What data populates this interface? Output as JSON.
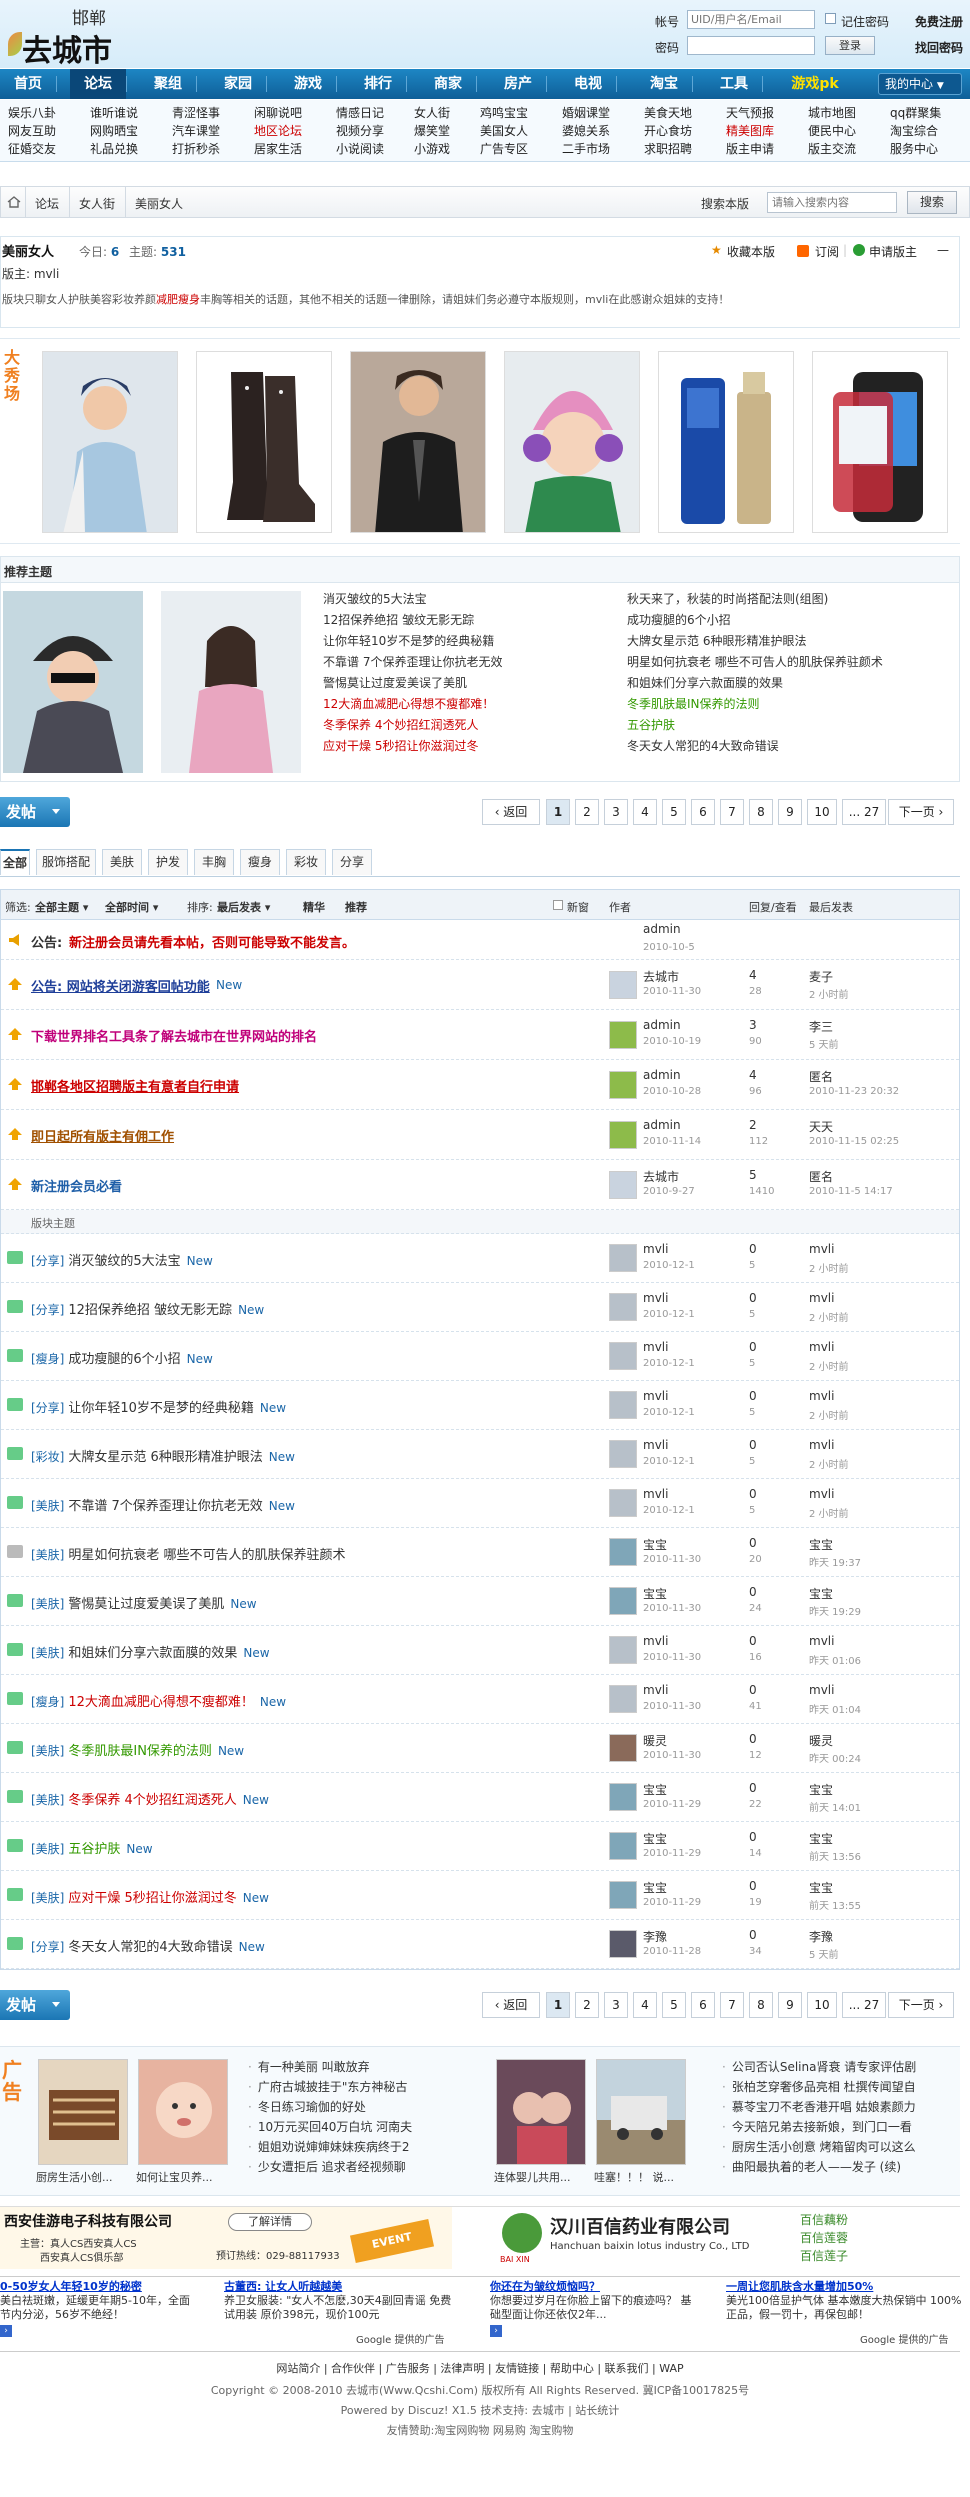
{
  "header": {
    "logo_sub": "邯郸",
    "logo_main": "去城市",
    "account_label": "帐号",
    "account_placeholder": "UID/用户名/Email",
    "remember": "记住密码",
    "register": "免费注册",
    "password_label": "密码",
    "login_button": "登录",
    "forgot": "找回密码"
  },
  "nav": {
    "items": [
      "首页",
      "论坛",
      "聚组",
      "家园",
      "游戏",
      "排行",
      "商家",
      "房产",
      "电视",
      "淘宝",
      "工具",
      "游戏pk"
    ],
    "center": "我的中心"
  },
  "subnav": {
    "cols": [
      [
        "娱乐八卦",
        "网友互助",
        "征婚交友"
      ],
      [
        "谁听谁说",
        "网购晒宝",
        "礼品兑换"
      ],
      [
        "青涩怪事",
        "汽车课堂",
        "打折秒杀"
      ],
      [
        "闲聊说吧",
        "地区论坛",
        "居家生活"
      ],
      [
        "情感日记",
        "视频分享",
        "小说阅读"
      ],
      [
        "女人街",
        "爆笑堂",
        "小游戏"
      ],
      [
        "鸡鸣宝宝",
        "美国女人",
        "广告专区"
      ],
      [
        "婚姻课堂",
        "婆媳关系",
        "二手市场"
      ],
      [
        "美食天地",
        "开心食坊",
        "求职招聘"
      ],
      [
        "天气预报",
        "精美图库",
        "版主申请"
      ],
      [
        "城市地图",
        "便民中心",
        "版主交流"
      ],
      [
        "qq群聚集",
        "淘宝综合",
        "服务中心"
      ]
    ]
  },
  "breadcrumb": {
    "items": [
      "论坛",
      "女人街",
      "美丽女人"
    ],
    "search_label": "搜索本版",
    "search_placeholder": "请输入搜索内容",
    "search_button": "搜索"
  },
  "forum": {
    "name": "美丽女人",
    "today_label": "今日:",
    "today": "6",
    "topics_label": "主题:",
    "topics": "531",
    "moderator": "版主: mvli",
    "desc_a": "版块只聊女人护肤美容彩妆养颜",
    "desc_b": "减肥瘦身",
    "desc_c": "丰胸等相关的话题，其他不相关的话题一律删除，请姐妹们务必遵守本版规则，mvli在此感谢众姐妹的支持！",
    "favorite": "收藏本版",
    "subscribe": "订阅",
    "apply": "申请版主",
    "collapse": "—"
  },
  "show": {
    "tag": "大秀场"
  },
  "recommend": {
    "title": "推荐主题",
    "col1": [
      {
        "t": "消灭皱纹的5大法宝",
        "c": "#333"
      },
      {
        "t": "12招保养绝招 皱纹无影无踪",
        "c": "#333"
      },
      {
        "t": "让你年轻10岁不是梦的经典秘籍",
        "c": "#333"
      },
      {
        "t": "不靠谱 7个保养歪理让你抗老无效",
        "c": "#333"
      },
      {
        "t": "警惕莫让过度爱美误了美肌",
        "c": "#333"
      },
      {
        "t": "12大滴血减肥心得想不瘦都难！",
        "c": "#c00"
      },
      {
        "t": "冬季保养 4个妙招红润透死人",
        "c": "#c00"
      },
      {
        "t": "应对干燥 5秒招让你滋润过冬",
        "c": "#c00"
      }
    ],
    "col2": [
      {
        "t": "秋天来了，秋装的时尚搭配法则(组图)",
        "c": "#333"
      },
      {
        "t": "成功瘦腿的6个小招",
        "c": "#333"
      },
      {
        "t": "大牌女星示范 6种眼形精准护眼法",
        "c": "#333"
      },
      {
        "t": "明星如何抗衰老 哪些不可告人的肌肤保养驻颜术",
        "c": "#333"
      },
      {
        "t": "和姐妹们分享六款面膜的效果",
        "c": "#333"
      },
      {
        "t": "冬季肌肤最IN保养的法则",
        "c": "#390"
      },
      {
        "t": "五谷护肤",
        "c": "#390"
      },
      {
        "t": "冬天女人常犯的4大致命错误",
        "c": "#333"
      }
    ]
  },
  "post_button": "发帖",
  "pager": {
    "prev": "‹ 返回",
    "pages": [
      "1",
      "2",
      "3",
      "4",
      "5",
      "6",
      "7",
      "8",
      "9",
      "10"
    ],
    "last": "... 27",
    "next": "下一页 ›"
  },
  "tabs": [
    "全部",
    "服饰搭配",
    "美肤",
    "护发",
    "丰胸",
    "瘦身",
    "彩妆",
    "分享"
  ],
  "table_head": {
    "filter": "筛选:",
    "all_topics": "全部主题",
    "all_time": "全部时间",
    "sort": "排序:",
    "latest": "最后发表",
    "digest": "精华",
    "recommend": "推荐",
    "new_window": "新窗",
    "author": "作者",
    "replies": "回复/查看",
    "last": "最后发表"
  },
  "announce": {
    "label": "公告:",
    "text": "新注册会员请先看本帖，否则可能导致不能发言。",
    "author": "admin",
    "date": "2010-10-5"
  },
  "sticky": [
    {
      "title": "公告: 网站将关闭游客回帖功能",
      "color": "#1f3f99",
      "u": true,
      "new": "New",
      "author": "去城市",
      "date": "2010-11-30",
      "r": "4",
      "v": "28",
      "lp": "麦子",
      "lt": "2 小时前",
      "av": "#c9d3df"
    },
    {
      "title": "下载世界排名工具条了解去城市在世界网站的排名",
      "color": "#c0007a",
      "u": false,
      "new": "",
      "author": "admin",
      "date": "2010-10-19",
      "r": "3",
      "v": "90",
      "lp": "李三",
      "lt": "5 天前",
      "av": "#8dbb4a"
    },
    {
      "title": "邯郸各地区招聘版主有意者自行申请",
      "color": "#c00",
      "u": true,
      "new": "",
      "author": "admin",
      "date": "2010-10-28",
      "r": "4",
      "v": "96",
      "lp": "匿名",
      "lt": "2010-11-23 20:32",
      "av": "#8dbb4a"
    },
    {
      "title": "即日起所有版主有佣工作",
      "color": "#a05000",
      "u": true,
      "new": "",
      "author": "admin",
      "date": "2010-11-14",
      "r": "2",
      "v": "112",
      "lp": "天天",
      "lt": "2010-11-15 02:25",
      "av": "#8dbb4a"
    },
    {
      "title": "新注册会员必看",
      "color": "#1f5fa8",
      "u": false,
      "new": "",
      "author": "去城市",
      "date": "2010-9-27",
      "r": "5",
      "v": "1410",
      "lp": "匿名",
      "lt": "2010-11-5 14:17",
      "av": "#c9d3df"
    }
  ],
  "section_label": "版块主题",
  "threads": [
    {
      "cat": "[分享]",
      "title": "消灭皱纹的5大法宝",
      "color": "#333",
      "new": "New",
      "author": "mvli",
      "date": "2010-12-1",
      "r": "0",
      "v": "5",
      "lp": "mvli",
      "lt": "2 小时前",
      "icon": "#6c8",
      "av": "#b7c0c9"
    },
    {
      "cat": "[分享]",
      "title": "12招保养绝招 皱纹无影无踪",
      "color": "#333",
      "new": "New",
      "author": "mvli",
      "date": "2010-12-1",
      "r": "0",
      "v": "5",
      "lp": "mvli",
      "lt": "2 小时前",
      "icon": "#6c8",
      "av": "#b7c0c9"
    },
    {
      "cat": "[瘦身]",
      "title": "成功瘦腿的6个小招",
      "color": "#333",
      "new": "New",
      "author": "mvli",
      "date": "2010-12-1",
      "r": "0",
      "v": "5",
      "lp": "mvli",
      "lt": "2 小时前",
      "icon": "#6c8",
      "av": "#b7c0c9"
    },
    {
      "cat": "[分享]",
      "title": "让你年轻10岁不是梦的经典秘籍",
      "color": "#333",
      "new": "New",
      "author": "mvli",
      "date": "2010-12-1",
      "r": "0",
      "v": "5",
      "lp": "mvli",
      "lt": "2 小时前",
      "icon": "#6c8",
      "av": "#b7c0c9"
    },
    {
      "cat": "[彩妆]",
      "title": "大牌女星示范 6种眼形精准护眼法",
      "color": "#333",
      "new": "New",
      "author": "mvli",
      "date": "2010-12-1",
      "r": "0",
      "v": "5",
      "lp": "mvli",
      "lt": "2 小时前",
      "icon": "#6c8",
      "av": "#b7c0c9"
    },
    {
      "cat": "[美肤]",
      "title": "不靠谱 7个保养歪理让你抗老无效",
      "color": "#333",
      "new": "New",
      "author": "mvli",
      "date": "2010-12-1",
      "r": "0",
      "v": "5",
      "lp": "mvli",
      "lt": "2 小时前",
      "icon": "#6c8",
      "av": "#b7c0c9"
    },
    {
      "cat": "[美肤]",
      "title": "明星如何抗衰老 哪些不可告人的肌肤保养驻颜术",
      "color": "#333",
      "new": "",
      "author": "宝宝",
      "date": "2010-11-30",
      "r": "0",
      "v": "20",
      "lp": "宝宝",
      "lt": "昨天 19:37",
      "icon": "#bbb",
      "av": "#7fa6b8"
    },
    {
      "cat": "[美肤]",
      "title": "警惕莫让过度爱美误了美肌",
      "color": "#333",
      "new": "New",
      "author": "宝宝",
      "date": "2010-11-30",
      "r": "0",
      "v": "24",
      "lp": "宝宝",
      "lt": "昨天 19:29",
      "icon": "#6c8",
      "av": "#7fa6b8"
    },
    {
      "cat": "[美肤]",
      "title": "和姐妹们分享六款面膜的效果",
      "color": "#333",
      "new": "New",
      "author": "mvli",
      "date": "2010-11-30",
      "r": "0",
      "v": "16",
      "lp": "mvli",
      "lt": "昨天 01:06",
      "icon": "#6c8",
      "av": "#b7c0c9"
    },
    {
      "cat": "[瘦身]",
      "title": "12大滴血减肥心得想不瘦都难！",
      "color": "#c00",
      "new": "New",
      "author": "mvli",
      "date": "2010-11-30",
      "r": "0",
      "v": "41",
      "lp": "mvli",
      "lt": "昨天 01:04",
      "icon": "#6c8",
      "av": "#b7c0c9"
    },
    {
      "cat": "[美肤]",
      "title": "冬季肌肤最IN保养的法则",
      "color": "#390",
      "new": "New",
      "author": "暖灵",
      "date": "2010-11-30",
      "r": "0",
      "v": "12",
      "lp": "暖灵",
      "lt": "昨天 00:24",
      "icon": "#6c8",
      "av": "#8a6a5a"
    },
    {
      "cat": "[美肤]",
      "title": "冬季保养 4个妙招红润透死人",
      "color": "#c00",
      "new": "New",
      "author": "宝宝",
      "date": "2010-11-29",
      "r": "0",
      "v": "22",
      "lp": "宝宝",
      "lt": "前天 14:01",
      "icon": "#6c8",
      "av": "#7fa6b8"
    },
    {
      "cat": "[美肤]",
      "title": "五谷护肤",
      "color": "#390",
      "new": "New",
      "author": "宝宝",
      "date": "2010-11-29",
      "r": "0",
      "v": "14",
      "lp": "宝宝",
      "lt": "前天 13:56",
      "icon": "#6c8",
      "av": "#7fa6b8"
    },
    {
      "cat": "[美肤]",
      "title": "应对干燥 5秒招让你滋润过冬",
      "color": "#c00",
      "new": "New",
      "author": "宝宝",
      "date": "2010-11-29",
      "r": "0",
      "v": "19",
      "lp": "宝宝",
      "lt": "前天 13:55",
      "icon": "#6c8",
      "av": "#7fa6b8"
    },
    {
      "cat": "[分享]",
      "title": "冬天女人常犯的4大致命错误",
      "color": "#333",
      "new": "New",
      "author": "李豫",
      "date": "2010-11-28",
      "r": "0",
      "v": "34",
      "lp": "李豫",
      "lt": "5 天前",
      "icon": "#6c8",
      "av": "#5a5a6a"
    }
  ],
  "bottom_show": {
    "tag": "广告",
    "captions": [
      "厨房生活小创...",
      "如何让宝贝养...",
      "连体婴儿共用...",
      "哇塞！！！ 说..."
    ],
    "col1": [
      "有一种美丽 叫敢放弃",
      "广府古城披挂于\"东方神秘古",
      "冬日练习瑜伽的好处",
      "10万元买回40万白坑 河南夫",
      "姐姐劝说婶婶妹妹疾病终于2",
      "少女遭拒后 追求者经视频聊"
    ],
    "col2": [
      "公司否认Selina肾衰 请专家评估剧",
      "张柏芝穿奢侈品亮相 杜撰传闻望自",
      "慕苓宝刀不老香港开唱 姑娘素颜力",
      "今天陪兄弟去接新娘，到门口一看",
      "厨房生活小创意 烤箱留肉可以这么",
      "曲阳最执着的老人——发子  (续)"
    ]
  },
  "ads": {
    "left_title": "西安佳游电子科技有限公司",
    "left_btn": "了解详情",
    "left_sub1": "主营：真人CS西安真人CS",
    "left_sub2": "西安真人CS俱乐部",
    "left_tel": "预订热线：029-88117933",
    "right_title": "汉川百信药业有限公司",
    "right_en": "Hanchuan baixin lotus industry Co., LTD",
    "right_tag1": "百信藕粉",
    "right_tag2": "百信莲蓉",
    "right_tag3": "百信莲子",
    "right_logo": "BAI XIN"
  },
  "gads": {
    "a1_title": "0-50岁女人年轻10岁的秘密",
    "a1_line1": "美白祛斑嫩，延缓更年期5-10年，全面",
    "a1_line2": "节内分泌，56岁不绝经！",
    "a2_title": "古董西: 让女人听越越美",
    "a2_line1": "养卫女服装: \"女人不怎麽,30天4副回青谣 免费",
    "a2_line2": "试用装 原价398元，现价100元",
    "a3_title": "你还在为皱纹烦恼吗？",
    "a3_line1": "你想要过岁月在你脸上留下的痕迹吗？ 基",
    "a3_line2": "础型面让你还依仅2年...",
    "a4_title": "一周让您肌肤含水量增加50%",
    "a4_line1": "美光100倍显护气体 基本嫩度大热保销中 100%",
    "a4_line2": "正品，假一罚十，再保包邮！",
    "google": "Google 提供的广告"
  },
  "footer": {
    "links": "网站简介 | 合作伙伴 | 广告服务 | 法律声明 | 友情链接 | 帮助中心 | 联系我们 | WAP",
    "copy": "Copyright © 2008-2010 去城市(Www.Qcshi.Com) 版权所有  All Rights Reserved. 冀ICP备10017825号",
    "powered": "Powered by Discuz! X1.5  技术支持: 去城市  | 站长统计",
    "friends": "友情赞助:淘宝网购物  网易购  淘宝购物"
  }
}
